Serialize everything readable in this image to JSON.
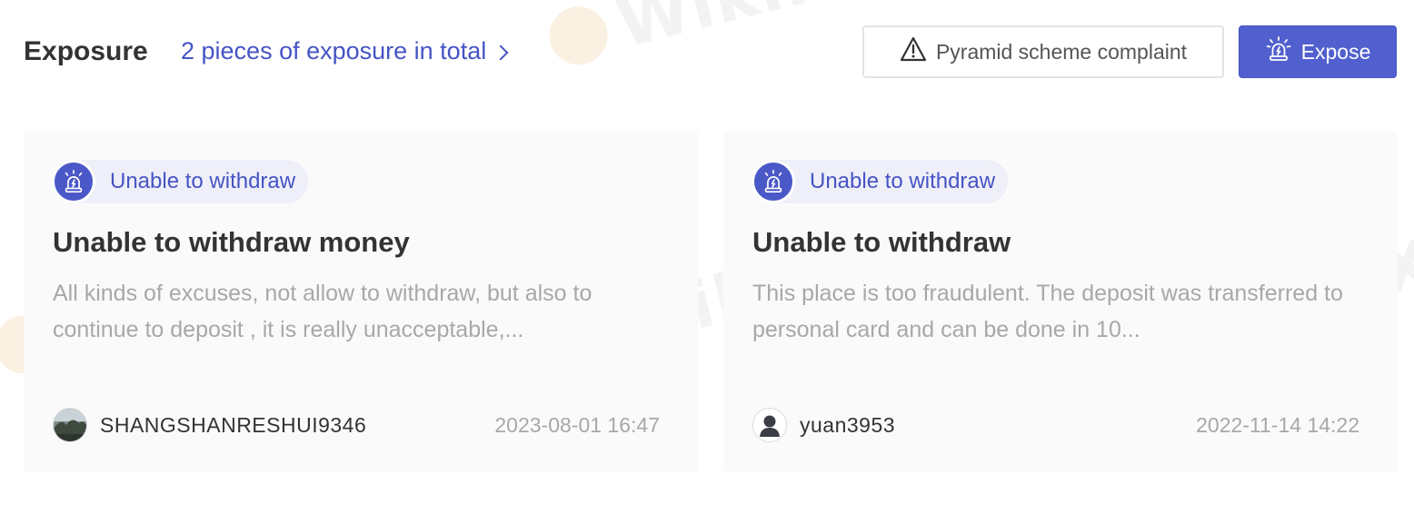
{
  "header": {
    "title": "Exposure",
    "total_link": "2 pieces of exposure in total",
    "complaint_button": "Pyramid scheme complaint",
    "expose_button": "Expose"
  },
  "watermark": "WikiFX",
  "cards": [
    {
      "tag": "Unable to withdraw",
      "title": "Unable to withdraw money",
      "body": "All kinds of excuses, not allow to withdraw, but also to continue to deposit , it is really unacceptable,...",
      "author": "SHANGSHANRESHUI9346",
      "date": "2023-08-01 16:47"
    },
    {
      "tag": "Unable to withdraw",
      "title": "Unable to withdraw",
      "body": "This place is too fraudulent. The deposit was transferred to personal card and can be done in 10...",
      "author": "yuan3953",
      "date": "2022-11-14 14:22"
    }
  ],
  "colors": {
    "accent": "#4654c4",
    "expose_button_bg": "#5160ce",
    "card_bg": "#fafafa"
  },
  "icons": {
    "complaint": "warning-triangle-icon",
    "expose": "alarm-siren-icon",
    "tag": "alarm-siren-icon",
    "link": "chevron-right-icon"
  }
}
